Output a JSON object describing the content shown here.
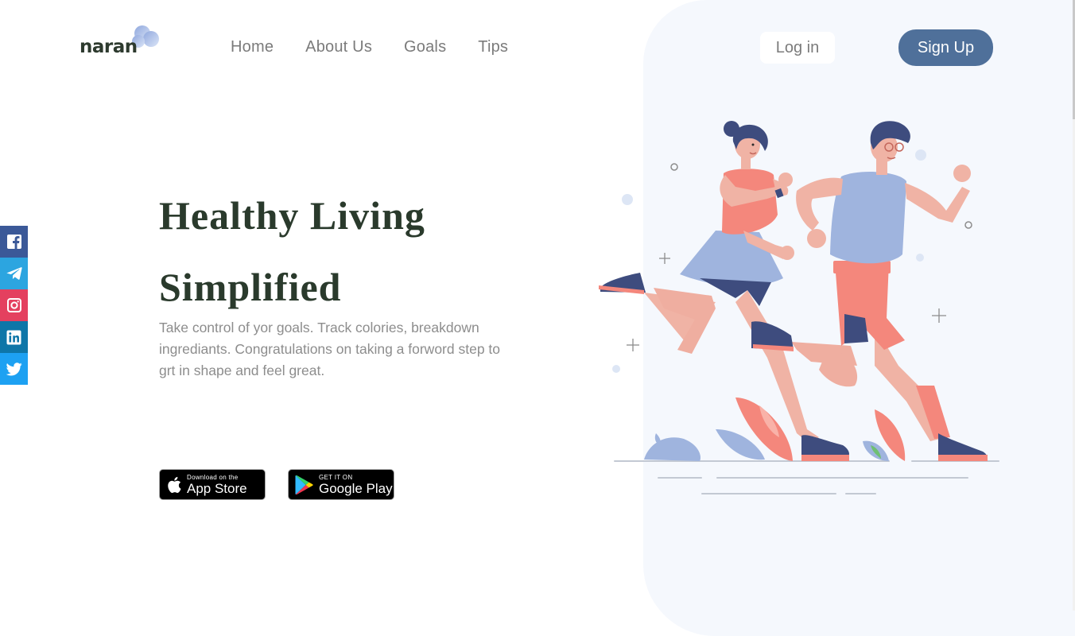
{
  "brand": {
    "name": "naran"
  },
  "nav": {
    "items": [
      {
        "label": "Home"
      },
      {
        "label": "About Us"
      },
      {
        "label": "Goals"
      },
      {
        "label": "Tips"
      }
    ]
  },
  "auth": {
    "login_label": "Log in",
    "signup_label": "Sign Up"
  },
  "hero": {
    "title_line1": "Healthy Living",
    "title_line2": "Simplified",
    "description": "Take control of yor goals. Track colories, breakdown ingrediants. Congratulations on taking a forword step to grt in shape and feel great."
  },
  "stores": {
    "app_store": {
      "small": "Download on the",
      "big": "App Store"
    },
    "google_play": {
      "small": "GET IT ON",
      "big": "Google Play"
    }
  },
  "social": [
    {
      "icon": "facebook-icon",
      "color": "#3b5998"
    },
    {
      "icon": "telegram-icon",
      "color": "#2ca5e0"
    },
    {
      "icon": "instagram-icon",
      "color": "#e4405f"
    },
    {
      "icon": "linkedin-icon",
      "color": "#0e76a8"
    },
    {
      "icon": "twitter-icon",
      "color": "#1da1f2"
    }
  ],
  "colors": {
    "accent": "#4f709a",
    "heading": "#2a3a2c",
    "panel": "#f5f8fd"
  }
}
